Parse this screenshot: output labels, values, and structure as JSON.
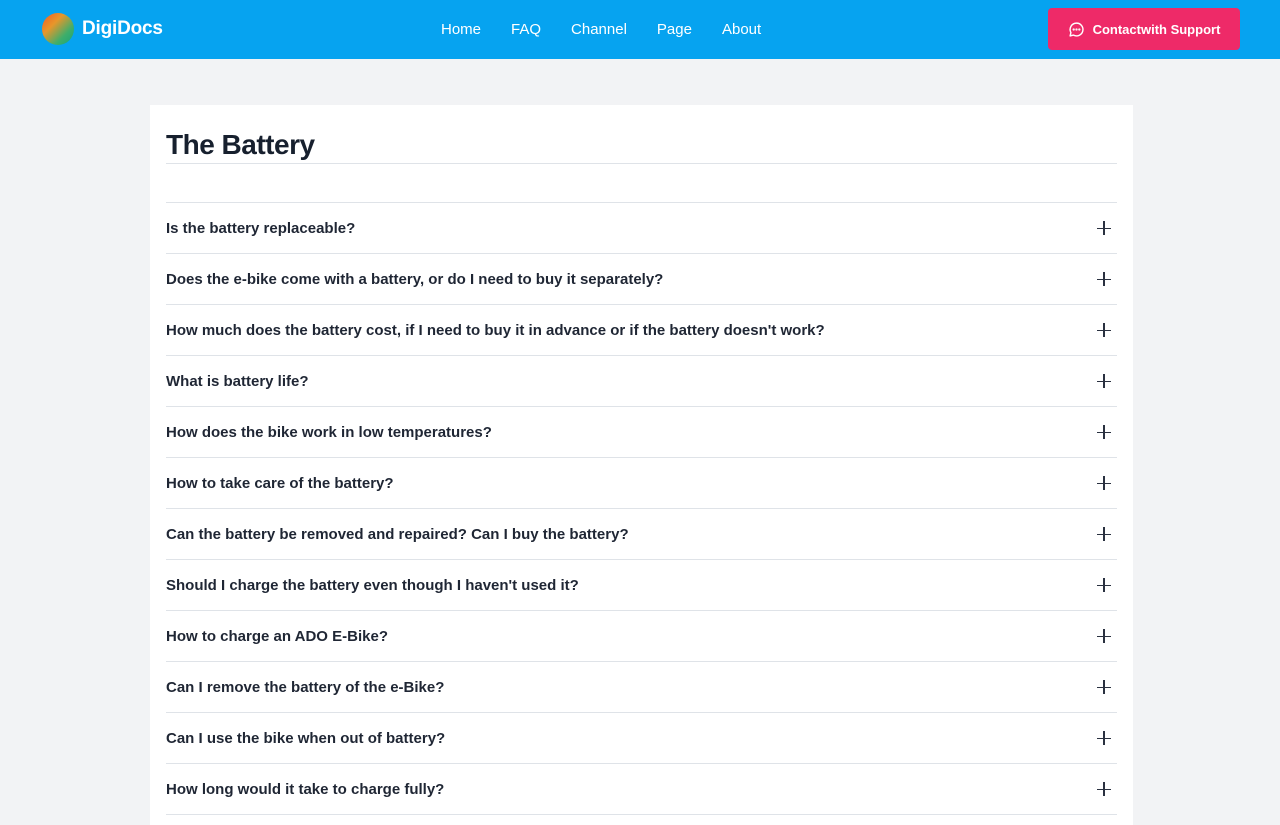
{
  "header": {
    "brand": "DigiDocs",
    "nav": [
      "Home",
      "FAQ",
      "Channel",
      "Page",
      "About"
    ],
    "support_label": "Contactwith Support",
    "background_color": "#06a3f0",
    "button_color": "#ee2a68"
  },
  "main": {
    "title": "The Battery",
    "questions": [
      "Is the battery replaceable?",
      "Does the e-bike come with a battery, or do I need to buy it separately?",
      "How much does the battery cost, if I need to buy it in advance or if the battery doesn't work?",
      "What is battery life?",
      "How does the bike work in low temperatures?",
      "How to take care of the battery?",
      "Can the battery be removed and repaired? Can I buy the battery?",
      "Should I charge the battery even though I haven't used it?",
      "How to charge an ADO E-Bike?",
      "Can I remove the battery of the e-Bike?",
      "Can I use the bike when out of battery?",
      "How long would it take to charge fully?"
    ],
    "expand_icon": "plus-icon"
  }
}
